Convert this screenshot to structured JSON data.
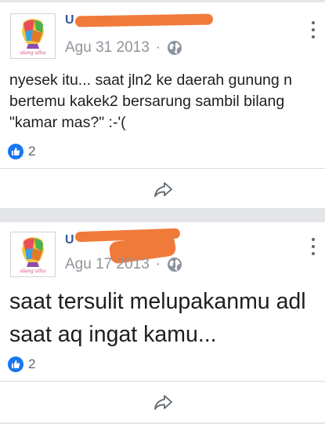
{
  "posts": [
    {
      "author": "U",
      "date": "Agu 31 2013",
      "separator": "·",
      "text": "nyesek itu... saat jln2 ke daerah gunung n bertemu kakek2 bersarung sambil bilang \"kamar mas?\" :-'(",
      "likes": "2",
      "privacy_icon": "globe-icon",
      "share_icon": "share-icon",
      "avatar_caption": "ulang utha"
    },
    {
      "author": "U",
      "date": "Agu 17 2013",
      "separator": "·",
      "text": "saat tersulit melupakanmu adl saat aq ingat kamu...",
      "likes": "2",
      "privacy_icon": "globe-icon",
      "share_icon": "share-icon",
      "avatar_caption": "ulang utha"
    }
  ],
  "colors": {
    "redaction": "#f07a3a",
    "like_blue": "#1877f2",
    "meta_grey": "#90949c"
  }
}
